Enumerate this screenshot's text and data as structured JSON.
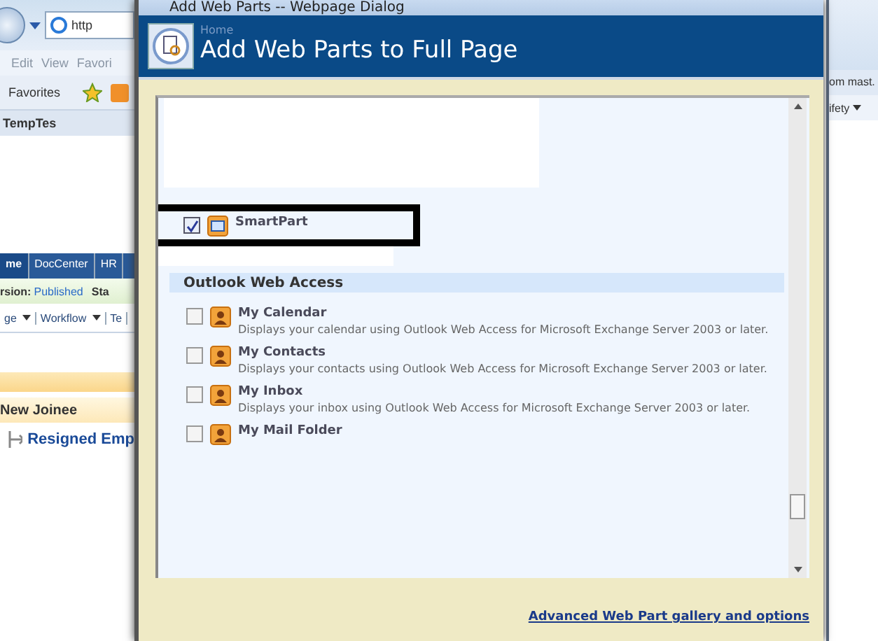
{
  "browser": {
    "address": "http",
    "menu": [
      "Edit",
      "View",
      "Favori"
    ],
    "favorites": "Favorites",
    "page_tab": "TempTes",
    "nav_tabs": [
      {
        "label": "me",
        "selected": true
      },
      {
        "label": "DocCenter",
        "selected": false
      },
      {
        "label": "HR",
        "selected": false
      }
    ],
    "version_label": "rsion:",
    "version_value": "Published",
    "status": "Sta",
    "toolbar": [
      {
        "label": "ge",
        "dropdown": true
      },
      {
        "label": "Workflow",
        "dropdown": true
      },
      {
        "label": "Te",
        "dropdown": false
      }
    ],
    "section": "New Joinee",
    "link": "Resigned Emp",
    "right_text": "om mast.",
    "right_menu": {
      "label": "ifety",
      "dropdown": true
    }
  },
  "dialog": {
    "title": "Add Web Parts -- Webpage Dialog",
    "breadcrumb": "Home",
    "heading": "Add Web Parts to Full Page",
    "items": [
      {
        "kind": "part",
        "name": "SmartPart",
        "checked": true,
        "highlighted": true
      },
      {
        "kind": "group",
        "name": "Outlook Web Access"
      },
      {
        "kind": "part",
        "name": "My Calendar",
        "description": "Displays your calendar using Outlook Web Access for Microsoft Exchange Server 2003 or later.",
        "checked": false,
        "highlighted": false
      },
      {
        "kind": "part",
        "name": "My Contacts",
        "description": "Displays your contacts using Outlook Web Access for Microsoft Exchange Server 2003 or later.",
        "checked": false,
        "highlighted": false
      },
      {
        "kind": "part",
        "name": "My Inbox",
        "description": "Displays your inbox using Outlook Web Access for Microsoft Exchange Server 2003 or later.",
        "checked": false,
        "highlighted": false
      },
      {
        "kind": "part",
        "name": "My Mail Folder",
        "checked": false,
        "highlighted": false
      }
    ],
    "link": "Advanced Web Part gallery and options"
  }
}
